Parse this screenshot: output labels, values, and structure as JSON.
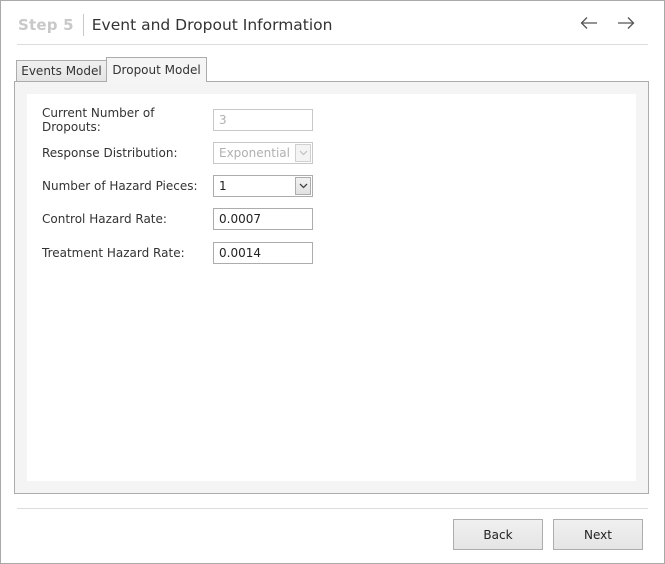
{
  "header": {
    "step": "Step 5",
    "title": "Event and Dropout Information",
    "back_icon": "arrow-left-icon",
    "forward_icon": "arrow-right-icon"
  },
  "tabs": [
    {
      "label": "Events Model",
      "active": false
    },
    {
      "label": "Dropout Model",
      "active": true
    }
  ],
  "form": {
    "current_dropouts": {
      "label": "Current Number of Dropouts:",
      "value": "3",
      "disabled": true
    },
    "response_distribution": {
      "label": "Response Distribution:",
      "value": "Exponential",
      "disabled": true,
      "icon": "chevron-down-icon"
    },
    "hazard_pieces": {
      "label": "Number of Hazard Pieces:",
      "value": "1",
      "disabled": false,
      "icon": "chevron-down-icon"
    },
    "control_hazard_rate": {
      "label": "Control Hazard Rate:",
      "value": "0.0007"
    },
    "treatment_hazard_rate": {
      "label": "Treatment Hazard Rate:",
      "value": "0.0014"
    }
  },
  "footer": {
    "back_label": "Back",
    "next_label": "Next"
  }
}
